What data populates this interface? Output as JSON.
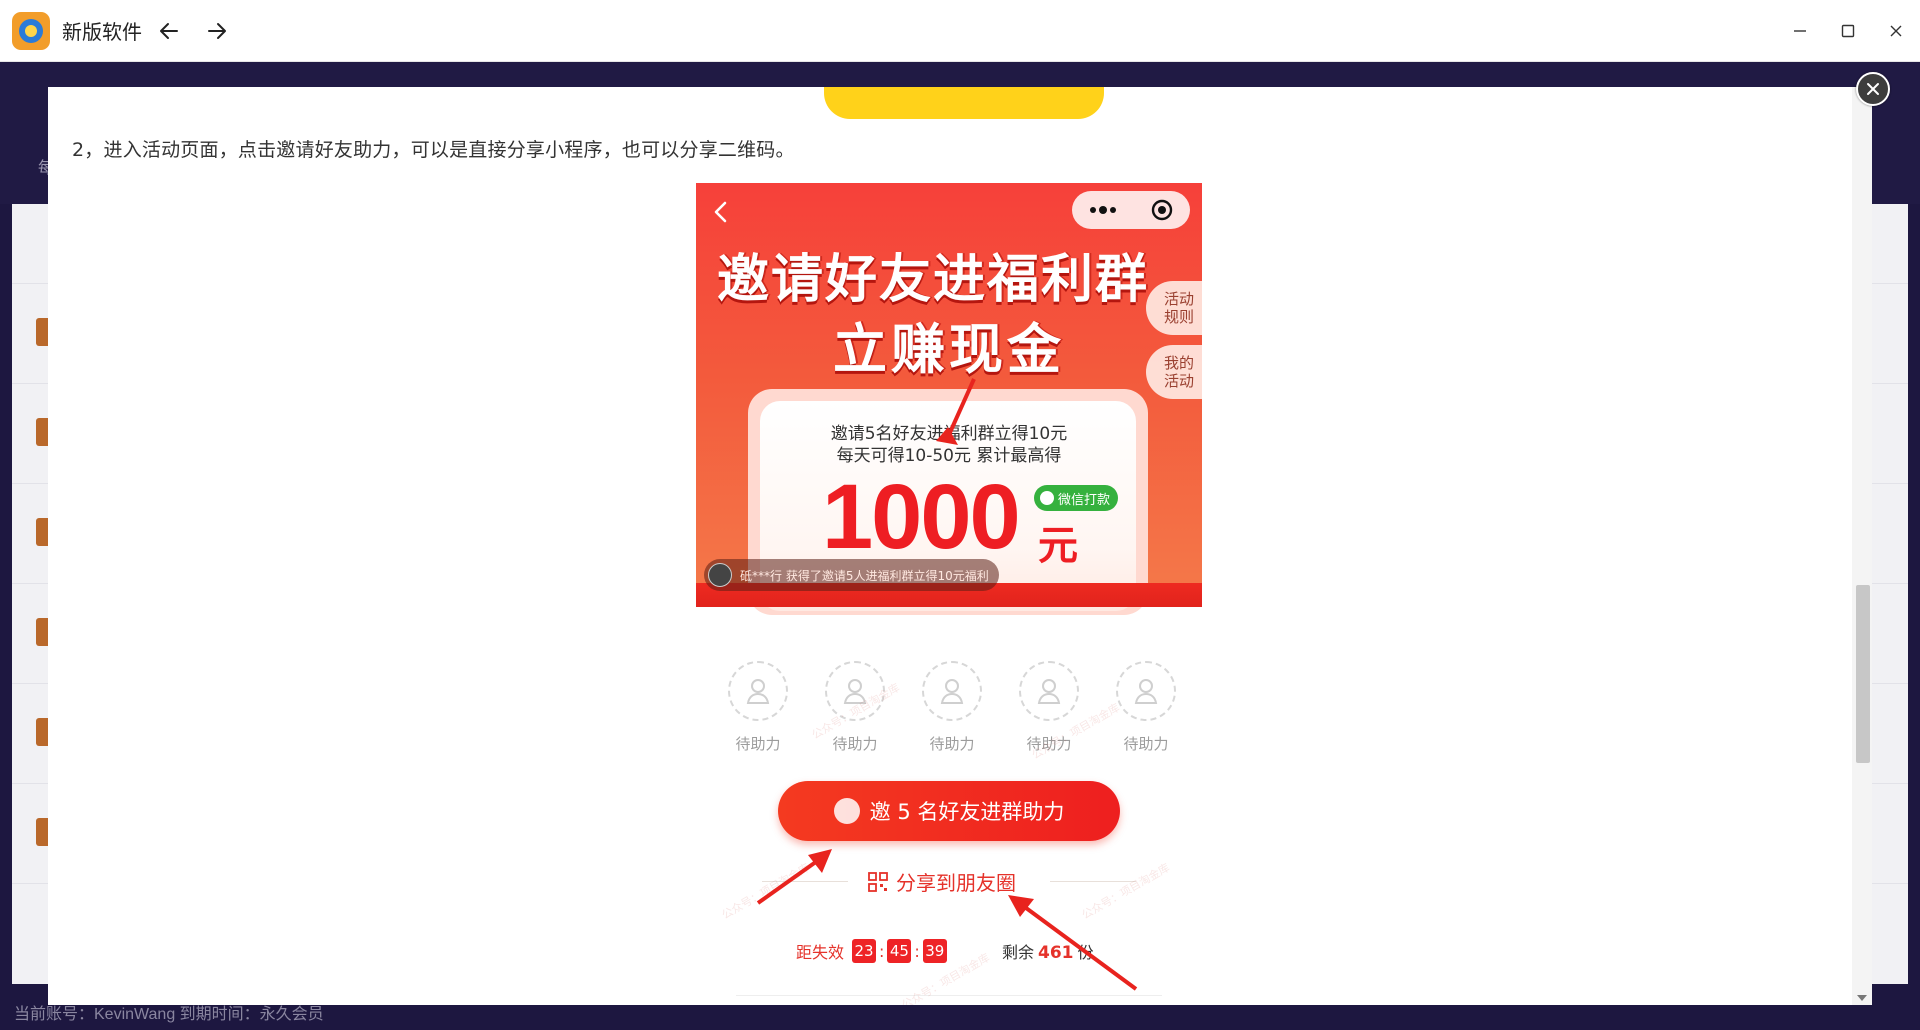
{
  "window": {
    "title": "新版软件",
    "controls": {
      "minimize": "minimize-icon",
      "maximize": "maximize-icon",
      "close": "close-icon"
    }
  },
  "background": {
    "footer": "当前账号：KevinWang    到期时间：永久会员",
    "side_text": "每"
  },
  "modal": {
    "step_text": "2，进入活动页面，点击邀请好友助力，可以是直接分享小程序，也可以分享二维码。",
    "close_icon": "close-icon"
  },
  "screenshot": {
    "headline_1": "邀请好友进福利群",
    "headline_2": "立赚现金",
    "rule_tab": "活动规则",
    "my_tab": "我的活动",
    "card_line_1": "邀请5名好友进福利群立得10元",
    "card_line_2": "每天可得10-50元 累计最高得",
    "amount": "1000",
    "amount_unit": "元",
    "wechat_pay": "微信打款",
    "ticker": "砥***行 获得了邀请5人进福利群立得10元福利",
    "helpers": [
      "待助力",
      "待助力",
      "待助力",
      "待助力",
      "待助力"
    ],
    "invite_button": "邀 5 名好友进群助力",
    "share_link": "分享到朋友圈",
    "expire_label": "距失效",
    "timer": {
      "h": "23",
      "m": "45",
      "s": "39"
    },
    "remain_label": "剩余",
    "remain_count": "461",
    "remain_unit": "份",
    "watermark": "公众号：项目淘金库"
  },
  "colors": {
    "accent_red": "#ee1e23",
    "wechat_green": "#35b13e",
    "highlight_yellow": "#ffd21a",
    "bg_dark": "#1d1740"
  }
}
